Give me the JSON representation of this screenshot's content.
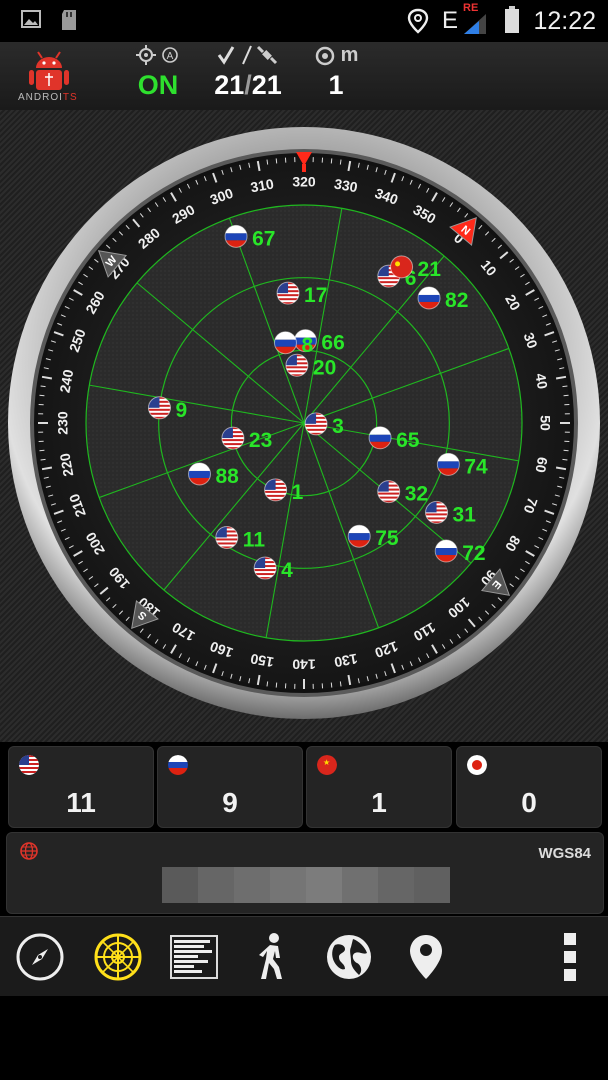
{
  "status_bar": {
    "time": "12:22",
    "network": "E",
    "network_badge": "RE"
  },
  "app": {
    "logo_text_a": "ANDROI",
    "logo_text_b": "TS"
  },
  "header": {
    "fix_status": "ON",
    "satellites_used": "21",
    "satellites_separator": "/",
    "satellites_visible": "21",
    "accuracy": "1",
    "accuracy_unit": "m"
  },
  "compass": {
    "degree_labels": [
      "0",
      "10",
      "20",
      "30",
      "40",
      "50",
      "60",
      "70",
      "80",
      "90",
      "100",
      "110",
      "120",
      "130",
      "140",
      "150",
      "160",
      "170",
      "180",
      "190",
      "200",
      "210",
      "220",
      "230",
      "240",
      "250",
      "260",
      "270",
      "280",
      "290",
      "300",
      "310",
      "320",
      "330",
      "340",
      "350"
    ],
    "cardinals": {
      "north": "N",
      "east": "E",
      "south": "S",
      "west": "W"
    },
    "heading_deg": 320
  },
  "satellites": [
    {
      "id": "6",
      "system": "us",
      "az": 350,
      "el": 20
    },
    {
      "id": "21",
      "system": "cn",
      "az": 352,
      "el": 14
    },
    {
      "id": "82",
      "system": "ru",
      "az": 5,
      "el": 17
    },
    {
      "id": "67",
      "system": "ru",
      "az": 300,
      "el": 8
    },
    {
      "id": "17",
      "system": "us",
      "az": 313,
      "el": 36
    },
    {
      "id": "66",
      "system": "ru",
      "az": 321,
      "el": 56
    },
    {
      "id": "8",
      "system": "ru",
      "az": 307,
      "el": 56
    },
    {
      "id": "20",
      "system": "us",
      "az": 313,
      "el": 66
    },
    {
      "id": "3",
      "system": "us",
      "az": 54,
      "el": 85
    },
    {
      "id": "65",
      "system": "ru",
      "az": 61,
      "el": 58
    },
    {
      "id": "74",
      "system": "ru",
      "az": 66,
      "el": 28
    },
    {
      "id": "31",
      "system": "us",
      "az": 84,
      "el": 24
    },
    {
      "id": "32",
      "system": "us",
      "az": 89,
      "el": 45
    },
    {
      "id": "72",
      "system": "ru",
      "az": 92,
      "el": 11
    },
    {
      "id": "75",
      "system": "ru",
      "az": 114,
      "el": 38
    },
    {
      "id": "9",
      "system": "us",
      "az": 236,
      "el": 30
    },
    {
      "id": "23",
      "system": "us",
      "az": 218,
      "el": 60
    },
    {
      "id": "88",
      "system": "ru",
      "az": 204,
      "el": 42
    },
    {
      "id": "1",
      "system": "us",
      "az": 163,
      "el": 60
    },
    {
      "id": "11",
      "system": "us",
      "az": 174,
      "el": 33
    },
    {
      "id": "4",
      "system": "us",
      "az": 155,
      "el": 28
    }
  ],
  "constellation_counts": [
    {
      "system": "us",
      "count": "11"
    },
    {
      "system": "ru",
      "count": "9"
    },
    {
      "system": "cn",
      "count": "1"
    },
    {
      "system": "jp",
      "count": "0"
    }
  ],
  "location": {
    "datum": "WGS84"
  },
  "toolbar": [
    "compass-tool",
    "radar-tool",
    "signal-bars-tool",
    "walk-tool",
    "globe-tool",
    "map-pin-tool",
    "menu-tool"
  ],
  "colors": {
    "accent_green": "#29e629",
    "radar_green": "#1fb81f",
    "needle_red": "#ff2a1a"
  }
}
